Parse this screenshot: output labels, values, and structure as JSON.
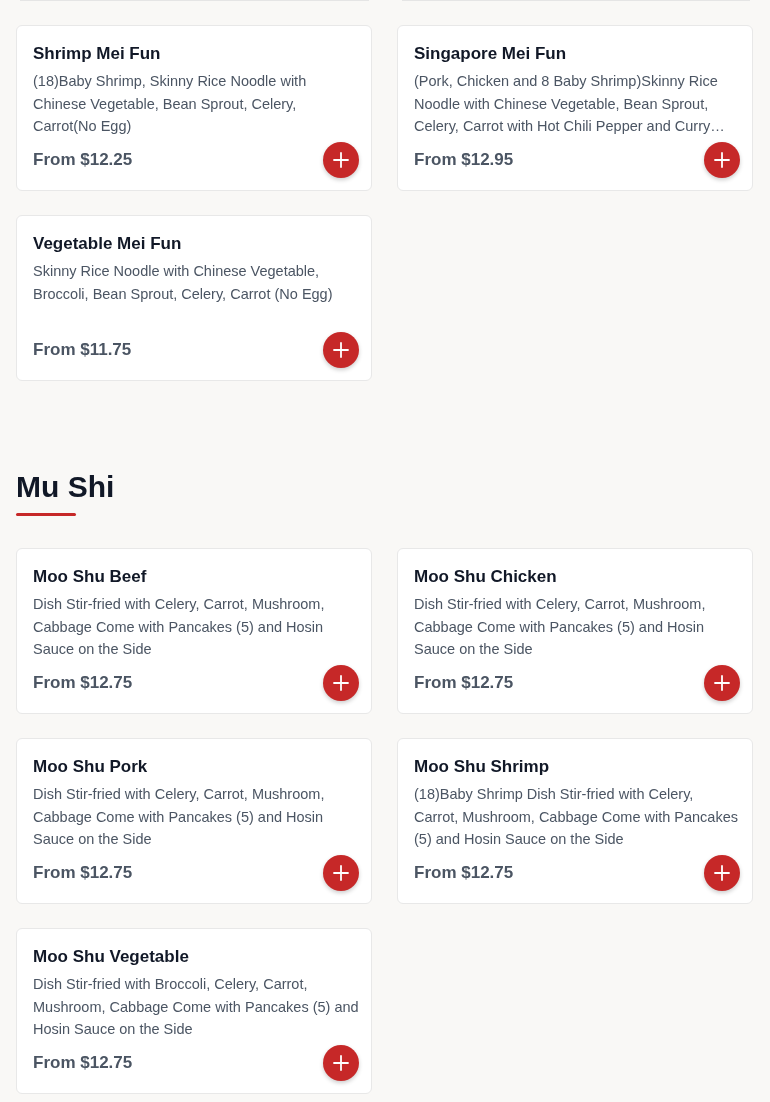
{
  "sections": [
    {
      "items": [
        {
          "name": "Shrimp Mei Fun",
          "description": "(18)Baby Shrimp, Skinny Rice Noodle with Chinese Vegetable, Bean Sprout, Celery, Carrot(No Egg)",
          "price": "From $12.25"
        },
        {
          "name": "Singapore Mei Fun",
          "description": "(Pork, Chicken and 8 Baby Shrimp)Skinny Rice Noodle with Chinese Vegetable, Bean Sprout, Celery, Carrot with Hot Chili Pepper and Curry…",
          "price": "From $12.95"
        },
        {
          "name": "Vegetable Mei Fun",
          "description": "Skinny Rice Noodle with Chinese Vegetable, Broccoli, Bean Sprout, Celery, Carrot (No Egg)",
          "price": "From $11.75"
        }
      ]
    },
    {
      "title": "Mu Shi",
      "items": [
        {
          "name": "Moo Shu Beef",
          "description": "Dish Stir-fried with Celery, Carrot, Mushroom, Cabbage Come with Pancakes (5) and Hosin Sauce on the Side",
          "price": "From $12.75"
        },
        {
          "name": "Moo Shu Chicken",
          "description": "Dish Stir-fried with Celery, Carrot, Mushroom, Cabbage Come with Pancakes (5) and Hosin Sauce on the Side",
          "price": "From $12.75"
        },
        {
          "name": "Moo Shu Pork",
          "description": "Dish Stir-fried with Celery, Carrot, Mushroom, Cabbage Come with Pancakes (5) and Hosin Sauce on the Side",
          "price": "From $12.75"
        },
        {
          "name": "Moo Shu Shrimp",
          "description": "(18)Baby Shrimp Dish Stir-fried with Celery, Carrot, Mushroom, Cabbage Come with Pancakes (5) and Hosin Sauce on the Side",
          "price": "From $12.75"
        },
        {
          "name": "Moo Shu Vegetable",
          "description": "Dish Stir-fried with Broccoli, Celery, Carrot, Mushroom, Cabbage Come with Pancakes (5) and Hosin Sauce on the Side",
          "price": "From $12.75"
        }
      ]
    }
  ]
}
